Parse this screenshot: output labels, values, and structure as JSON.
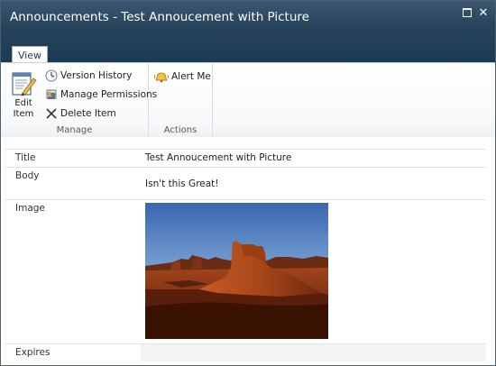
{
  "window": {
    "title": "Announcements - Test Annoucement with Picture"
  },
  "ribbon": {
    "tab": "View",
    "edit_item": [
      "Edit",
      "Item"
    ],
    "version_history": "Version History",
    "manage_permissions": "Manage Permissions",
    "delete_item": "Delete Item",
    "manage_group": "Manage",
    "alert_me": "Alert Me",
    "actions_group": "Actions"
  },
  "fields": {
    "title_label": "Title",
    "title_value": "Test Annoucement with Picture",
    "body_label": "Body",
    "body_value": "Isn't this Great!",
    "image_label": "Image",
    "expires_label": "Expires",
    "expires_value": ""
  },
  "icons": {
    "maximize": "maximize-icon",
    "close": "close-icon",
    "edit": "edit-item-icon",
    "version": "version-history-icon",
    "permissions": "manage-permissions-icon",
    "delete": "delete-item-icon",
    "alert": "alert-me-icon"
  },
  "colors": {
    "titlebar": "#27435c",
    "title_text": "#ffffff",
    "row_shade": "#f4f4f4"
  }
}
